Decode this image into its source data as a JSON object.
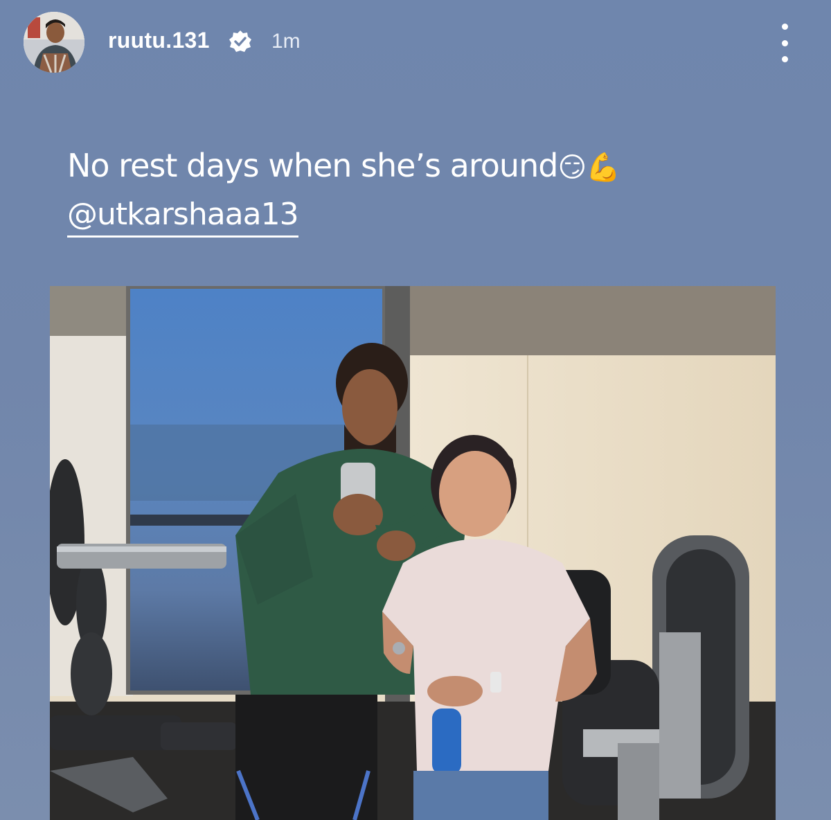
{
  "story": {
    "username": "ruutu.131",
    "time": "1m",
    "caption_text": "No rest days when she’s around",
    "caption_emojis": "😏💪",
    "mention": "@utkarshaaa13"
  },
  "icons": {
    "verified": "verified-badge-icon",
    "more": "more-vertical-icon"
  },
  "colors": {
    "background": "#7186ab",
    "text": "#ffffff"
  }
}
